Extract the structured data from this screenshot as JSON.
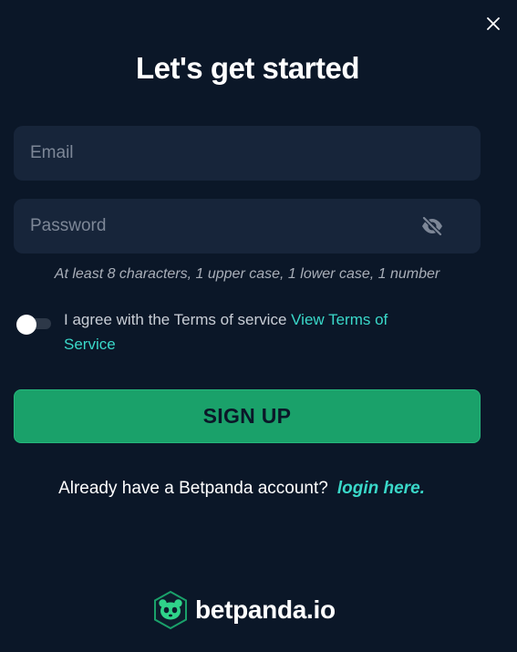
{
  "modal": {
    "title": "Let's get started",
    "close_icon": "close-icon"
  },
  "form": {
    "email": {
      "placeholder": "Email",
      "value": ""
    },
    "password": {
      "placeholder": "Password",
      "value": "",
      "visibility_icon": "eye-slash-icon"
    },
    "password_hint": "At least 8 characters, 1 upper case, 1 lower case, 1 number",
    "terms": {
      "toggle_on": false,
      "text": "I agree with the Terms of service",
      "link": "View Terms of Service"
    },
    "signup_label": "SIGN UP"
  },
  "login": {
    "prompt": "Already have a Betpanda account?",
    "link": "login here."
  },
  "brand": {
    "logo_icon": "panda-logo-icon",
    "name": "betpanda.io"
  },
  "colors": {
    "background": "#0b1728",
    "field": "#17253a",
    "accent_green": "#1aa16a",
    "link_teal": "#3ad8c9"
  }
}
